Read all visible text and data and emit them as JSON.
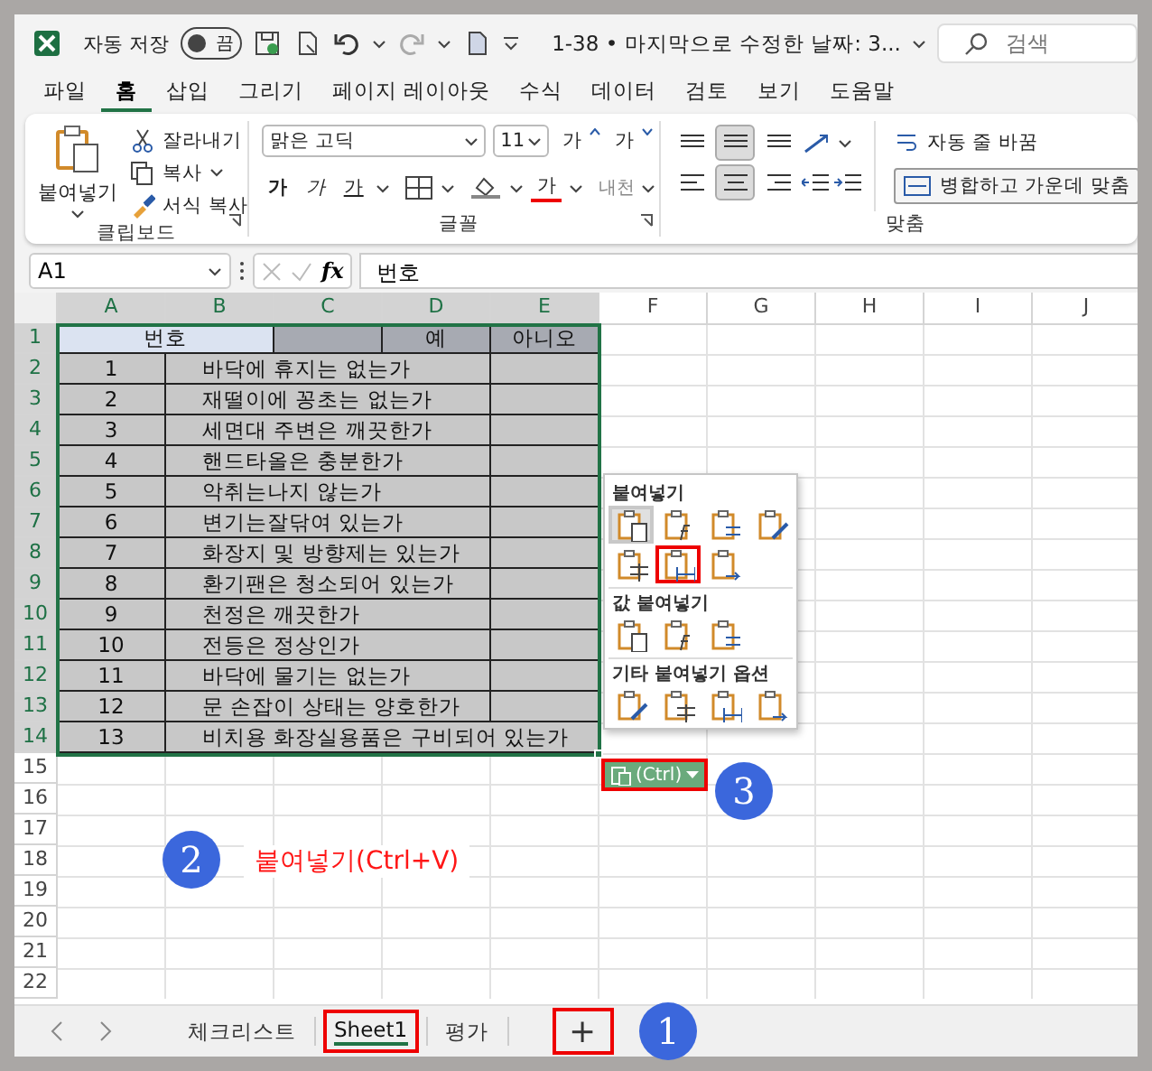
{
  "title_bar": {
    "autosave_label": "자동 저장",
    "autosave": {
      "label": "끔",
      "on": false
    },
    "document_title": "1-38 • 마지막으로 수정한 날짜: 3...",
    "search": {
      "placeholder": "검색"
    }
  },
  "menu_tabs": [
    {
      "label": "파일",
      "selected": false
    },
    {
      "label": "홈",
      "selected": true
    },
    {
      "label": "삽입",
      "selected": false
    },
    {
      "label": "그리기",
      "selected": false
    },
    {
      "label": "페이지 레이아웃",
      "selected": false
    },
    {
      "label": "수식",
      "selected": false
    },
    {
      "label": "데이터",
      "selected": false
    },
    {
      "label": "검토",
      "selected": false
    },
    {
      "label": "보기",
      "selected": false
    },
    {
      "label": "도움말",
      "selected": false
    }
  ],
  "ribbon": {
    "clipboard": {
      "paste": "붙여넣기",
      "cut": "잘라내기",
      "copy": "복사",
      "format_painter": "서식 복사",
      "label": "클립보드"
    },
    "font": {
      "name": "맑은 고딕",
      "size": "11",
      "grow": "가",
      "shrink": "가",
      "bold": "가",
      "italic": "가",
      "underline": "가",
      "font_color": "가",
      "phonetic_guide": "내천",
      "label": "글꼴"
    },
    "alignment": {
      "vertical": [
        {
          "selected": false
        },
        {
          "selected": true
        },
        {
          "selected": false
        }
      ],
      "horizontal": [
        {
          "selected": false
        },
        {
          "selected": true
        },
        {
          "selected": false
        }
      ],
      "wrap_text": "자동 줄 바꿈",
      "merge_center": "병합하고 가운데 맞춤",
      "label": "맞춤"
    }
  },
  "formula_bar": {
    "name_box": "A1",
    "function_label": "fx",
    "value": "번호"
  },
  "columns": [
    {
      "label": "A",
      "selected": true
    },
    {
      "label": "B",
      "selected": true
    },
    {
      "label": "C",
      "selected": true
    },
    {
      "label": "D",
      "selected": true
    },
    {
      "label": "E",
      "selected": true
    },
    {
      "label": "F",
      "selected": false
    },
    {
      "label": "G",
      "selected": false
    },
    {
      "label": "H",
      "selected": false
    },
    {
      "label": "I",
      "selected": false
    },
    {
      "label": "J",
      "selected": false
    }
  ],
  "rows": [
    {
      "number": "1",
      "selected": true,
      "kind": "header",
      "title": "번호",
      "title_active": true,
      "yes": "예",
      "no": "아니오"
    },
    {
      "number": "2",
      "selected": true,
      "kind": "item",
      "item_no": "1",
      "question": "바닥에 휴지는 없는가"
    },
    {
      "number": "3",
      "selected": true,
      "kind": "item",
      "item_no": "2",
      "question": "재떨이에 꽁초는 없는가"
    },
    {
      "number": "4",
      "selected": true,
      "kind": "item",
      "item_no": "3",
      "question": "세면대 주변은 깨끗한가"
    },
    {
      "number": "5",
      "selected": true,
      "kind": "item",
      "item_no": "4",
      "question": "핸드타올은 충분한가"
    },
    {
      "number": "6",
      "selected": true,
      "kind": "item",
      "item_no": "5",
      "question": "악취는나지 않는가"
    },
    {
      "number": "7",
      "selected": true,
      "kind": "item",
      "item_no": "6",
      "question": "변기는잘닦여 있는가"
    },
    {
      "number": "8",
      "selected": true,
      "kind": "item",
      "item_no": "7",
      "question": "화장지 및 방향제는 있는가"
    },
    {
      "number": "9",
      "selected": true,
      "kind": "item",
      "item_no": "8",
      "question": "환기팬은 청소되어 있는가"
    },
    {
      "number": "10",
      "selected": true,
      "kind": "item",
      "item_no": "9",
      "question": "천정은 깨끗한가"
    },
    {
      "number": "11",
      "selected": true,
      "kind": "item",
      "item_no": "10",
      "question": "전등은 정상인가"
    },
    {
      "number": "12",
      "selected": true,
      "kind": "item",
      "item_no": "11",
      "question": "바닥에 물기는 없는가"
    },
    {
      "number": "13",
      "selected": true,
      "kind": "item",
      "item_no": "12",
      "question": "문 손잡이 상태는 양호한가"
    },
    {
      "number": "14",
      "selected": true,
      "kind": "item_wide",
      "item_no": "13",
      "question": "비치용 화장실용품은 구비되어 있는가"
    },
    {
      "number": "15",
      "selected": false,
      "kind": "empty"
    },
    {
      "number": "16",
      "selected": false,
      "kind": "empty"
    },
    {
      "number": "17",
      "selected": false,
      "kind": "empty"
    },
    {
      "number": "18",
      "selected": false,
      "kind": "empty"
    },
    {
      "number": "19",
      "selected": false,
      "kind": "empty"
    },
    {
      "number": "20",
      "selected": false,
      "kind": "empty"
    },
    {
      "number": "21",
      "selected": false,
      "kind": "empty"
    },
    {
      "number": "22",
      "selected": false,
      "kind": "empty"
    }
  ],
  "paste_menu": {
    "sections": [
      {
        "title": "붙여넣기",
        "options": [
          {
            "highlighted": true,
            "marked": false
          },
          {
            "highlighted": false,
            "marked": false
          },
          {
            "highlighted": false,
            "marked": false
          },
          {
            "highlighted": false,
            "marked": false
          },
          {
            "highlighted": false,
            "marked": false
          },
          {
            "highlighted": false,
            "marked": true
          },
          {
            "highlighted": false,
            "marked": false
          }
        ]
      },
      {
        "title": "값 붙여넣기",
        "options": [
          {
            "highlighted": false,
            "marked": false
          },
          {
            "highlighted": false,
            "marked": false
          },
          {
            "highlighted": false,
            "marked": false
          }
        ]
      },
      {
        "title": "기타 붙여넣기 옵션",
        "options": [
          {
            "highlighted": false,
            "marked": false
          },
          {
            "highlighted": false,
            "marked": false
          },
          {
            "highlighted": false,
            "marked": false
          },
          {
            "highlighted": false,
            "marked": false
          }
        ]
      }
    ],
    "ctrl_button": {
      "label": "(Ctrl)",
      "marked": true
    }
  },
  "annotations": {
    "callouts": [
      {
        "number": "1"
      },
      {
        "number": "2"
      },
      {
        "number": "3"
      }
    ],
    "label": "붙여넣기(Ctrl+V)"
  },
  "sheet_tabs": [
    {
      "label": "체크리스트",
      "selected": false,
      "marked": false
    },
    {
      "label": "Sheet1",
      "selected": true,
      "marked": true
    },
    {
      "label": "평가",
      "selected": false,
      "marked": false
    }
  ],
  "add_sheet": {
    "label": "+",
    "marked": true
  }
}
